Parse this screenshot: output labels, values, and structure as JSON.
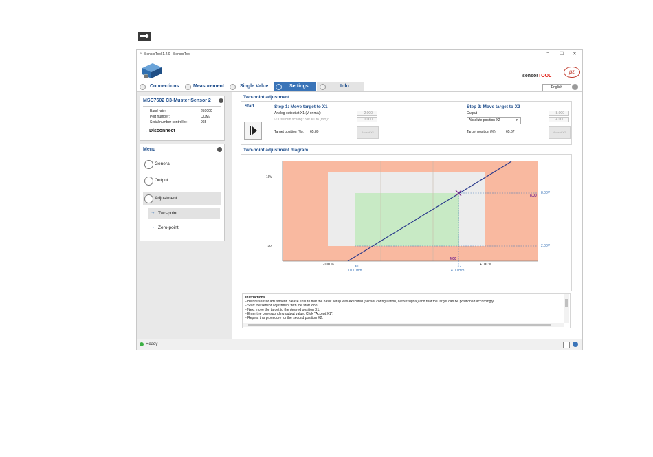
{
  "window": {
    "title": "SensorTool 1.2.0 - SensorTool",
    "minimize": "−",
    "maximize": "☐",
    "close": "✕"
  },
  "header": {
    "brand_sensor": "sensor",
    "brand_tool": "TOOL",
    "logo_text": "μɛ"
  },
  "tabs": [
    "Connections",
    "Measurement",
    "Single Value",
    "Settings",
    "Info"
  ],
  "active_tab": "Settings",
  "language": "English",
  "sensor": {
    "title": "MSC7602 C3-Muster Sensor 2",
    "rows": [
      {
        "label": "Baud rate:",
        "value": "250000"
      },
      {
        "label": "Port number:",
        "value": "COM7"
      },
      {
        "label": "Serial number controller:",
        "value": "965"
      }
    ],
    "disconnect": "Disconnect"
  },
  "menu": {
    "title": "Menu",
    "items": [
      "General",
      "Output",
      "Adjustment"
    ],
    "subitems": [
      "Two-point",
      "Zero-point"
    ]
  },
  "twopoint": {
    "title": "Two-point adjustment",
    "start": "Start",
    "step1_title": "Step 1: Move target to X1",
    "step1_label1": "Analog output at X1 (V or mA):",
    "step1_value1": "2.000",
    "step1_label2": "Use mm scaling: Set X1 to (mm):",
    "step1_value2": "0.000",
    "step1_target": "Target position (%):",
    "step1_target_value": "65.89",
    "accept1": "Accept X1",
    "step2_title": "Step 2: Move target to X2",
    "step2_label": "Output",
    "step2_select": "Absolute position X2",
    "step2_value1": "8.000",
    "step2_value2": "4.000",
    "step2_target": "Target position (%):",
    "step2_target_value": "65.67",
    "accept2": "Accept X2"
  },
  "diagram": {
    "title": "Two-point adjustment diagram",
    "y_top": "10V",
    "y_bottom": "2V",
    "x_left": "-100 %",
    "x_right": "+100 %",
    "x1_label": "X1",
    "x1_sub": "0.00 mm",
    "x2_label": "X2",
    "x2_sub": "4.00 mm",
    "right_top": "8.00V",
    "right_bottom": "2.00V",
    "point_value": "8.00",
    "x2_value": "4.00",
    "colors": {
      "outer": "#f9b9a0",
      "mid": "#ececec",
      "inner": "#c8eac5",
      "line": "#2a3a8c"
    }
  },
  "instructions": {
    "title": "Instructions",
    "lines": [
      "- Before sensor adjustment, please ensure that the basic setup was executed (sensor configuration, output signal) and that the target can be positioned accordingly.",
      "- Start the sensor adjustment with the start icon.",
      "- Next move the target to the desired position X1.",
      "- Enter the corresponding output value. Click \"Accept X1\".",
      "- Repeat this procedure for the second position X2."
    ]
  },
  "status": {
    "text": "Ready"
  }
}
